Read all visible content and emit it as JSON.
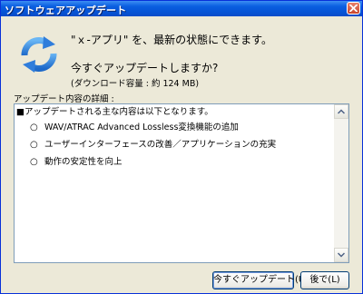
{
  "window": {
    "title": "ソフトウェアアップデート"
  },
  "message": {
    "headline": "\"ｘ-アプリ\" を、最新の状態にできます。",
    "question": "今すぐアップデートしますか?",
    "size_note": "(ダウンロード容量 : 約 124 MB)"
  },
  "details": {
    "label": "アップデート内容の詳細 :",
    "intro": "■アップデートされる主な内容は以下となります。",
    "bullet_symbol": "○",
    "items": [
      "WAV/ATRAC Advanced Lossless変換機能の追加",
      "ユーザーインターフェースの改善／アプリケーションの充実",
      "動作の安定性を向上"
    ]
  },
  "buttons": {
    "update_now": "今すぐアップデート(U)",
    "later": "後で(L)"
  },
  "icons": {
    "update": "update-refresh-icon",
    "close": "close-icon"
  },
  "colors": {
    "titlebar": "#0654d6",
    "dialog_bg": "#ece9d8",
    "icon_blue": "#3a86d9",
    "close_red": "#d0543a"
  }
}
